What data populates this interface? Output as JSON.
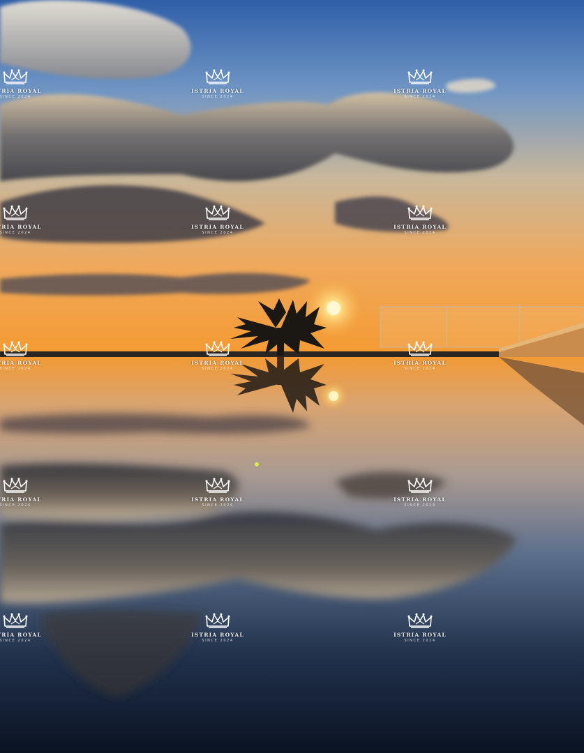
{
  "image": {
    "sky_top_color": "#3f6fb2",
    "horizon_color": "#f4a43a",
    "sun_color": "#fff6c2",
    "water_dark_color": "#0b1626"
  },
  "watermark": {
    "brand": "ISTRIA ROYAL",
    "since": "SINCE 2024",
    "icon": "crown-icon"
  }
}
